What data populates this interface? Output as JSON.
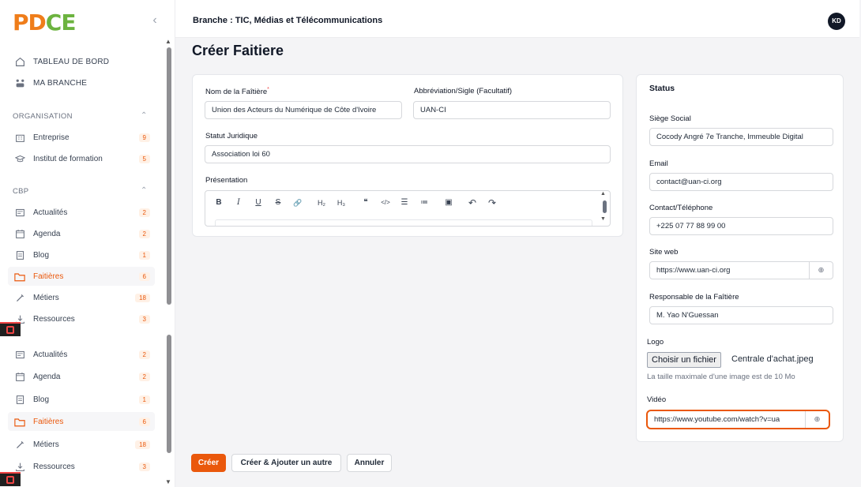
{
  "logo": {
    "p": "P",
    "d": "D",
    "c": "C",
    "e": "E"
  },
  "sidebar": {
    "collapse": "‹",
    "top": [
      {
        "label": "TABLEAU DE BORD",
        "icon": "home-icon"
      },
      {
        "label": "MA BRANCHE",
        "icon": "branch-icon"
      }
    ],
    "organisation": {
      "title": "ORGANISATION",
      "items": [
        {
          "label": "Entreprise",
          "count": "9"
        },
        {
          "label": "Institut de formation",
          "count": "5"
        }
      ]
    },
    "cbp": {
      "title": "CBP",
      "items": [
        {
          "label": "Actualités",
          "count": "2"
        },
        {
          "label": "Agenda",
          "count": "2"
        },
        {
          "label": "Blog",
          "count": "1"
        },
        {
          "label": "Faitières",
          "count": "6"
        },
        {
          "label": "Métiers",
          "count": "18"
        },
        {
          "label": "Ressources",
          "count": "3"
        }
      ]
    },
    "cbp_repeat": [
      {
        "label": "Actualités",
        "count": "2"
      },
      {
        "label": "Agenda",
        "count": "2"
      },
      {
        "label": "Blog",
        "count": "1"
      },
      {
        "label": "Faitières",
        "count": "6"
      },
      {
        "label": "Métiers",
        "count": "18"
      },
      {
        "label": "Ressources",
        "count": "3"
      }
    ]
  },
  "header": {
    "branch": "Branche : TIC, Médias et Télécommunications",
    "avatar": "KD"
  },
  "page": {
    "title": "Créer Faitiere"
  },
  "form": {
    "nom_label": "Nom de la Faîtière",
    "nom_required": "*",
    "nom_value": "Union des Acteurs du Numérique de Côte d'Ivoire",
    "abbr_label": "Abbréviation/Sigle (Facultatif)",
    "abbr_value": "UAN-CI",
    "statut_label": "Statut Juridique",
    "statut_value": "Association loi 60",
    "presentation_label": "Présentation",
    "toolbar": {
      "bold": "B",
      "italic": "I",
      "underline": "U",
      "strike": "S",
      "link": "🔗",
      "h2": "H₂",
      "h3": "H₃",
      "quote": "❝",
      "code": "</>",
      "bullets": "☰",
      "numbered": "≔",
      "image": "▣",
      "undo": "↶",
      "redo": "↷"
    }
  },
  "status": {
    "title": "Status",
    "siege_label": "Siège Social",
    "siege_value": "Cocody Angré 7e Tranche, Immeuble Digital",
    "email_label": "Email",
    "email_value": "contact@uan-ci.org",
    "contact_label": "Contact/Téléphone",
    "contact_value": "+225 07 77 88 99 00",
    "site_label": "Site web",
    "site_value": "https://www.uan-ci.org",
    "resp_label": "Responsable de la Faîtière",
    "resp_value": "M. Yao N'Guessan",
    "logo_label": "Logo",
    "file_button": "Choisir un fichier",
    "file_name": "Centrale d'achat.jpeg",
    "file_hint": "La taille maximale d'une image est de 10 Mo",
    "video_label": "Vidéo",
    "video_value": "https://www.youtube.com/watch?v=ua"
  },
  "actions": {
    "create": "Créer",
    "create_add": "Créer & Ajouter un autre",
    "cancel": "Annuler"
  },
  "colors": {
    "accent": "#ea580c",
    "brand_orange": "#ef7d1a",
    "brand_green": "#6cb33f"
  }
}
